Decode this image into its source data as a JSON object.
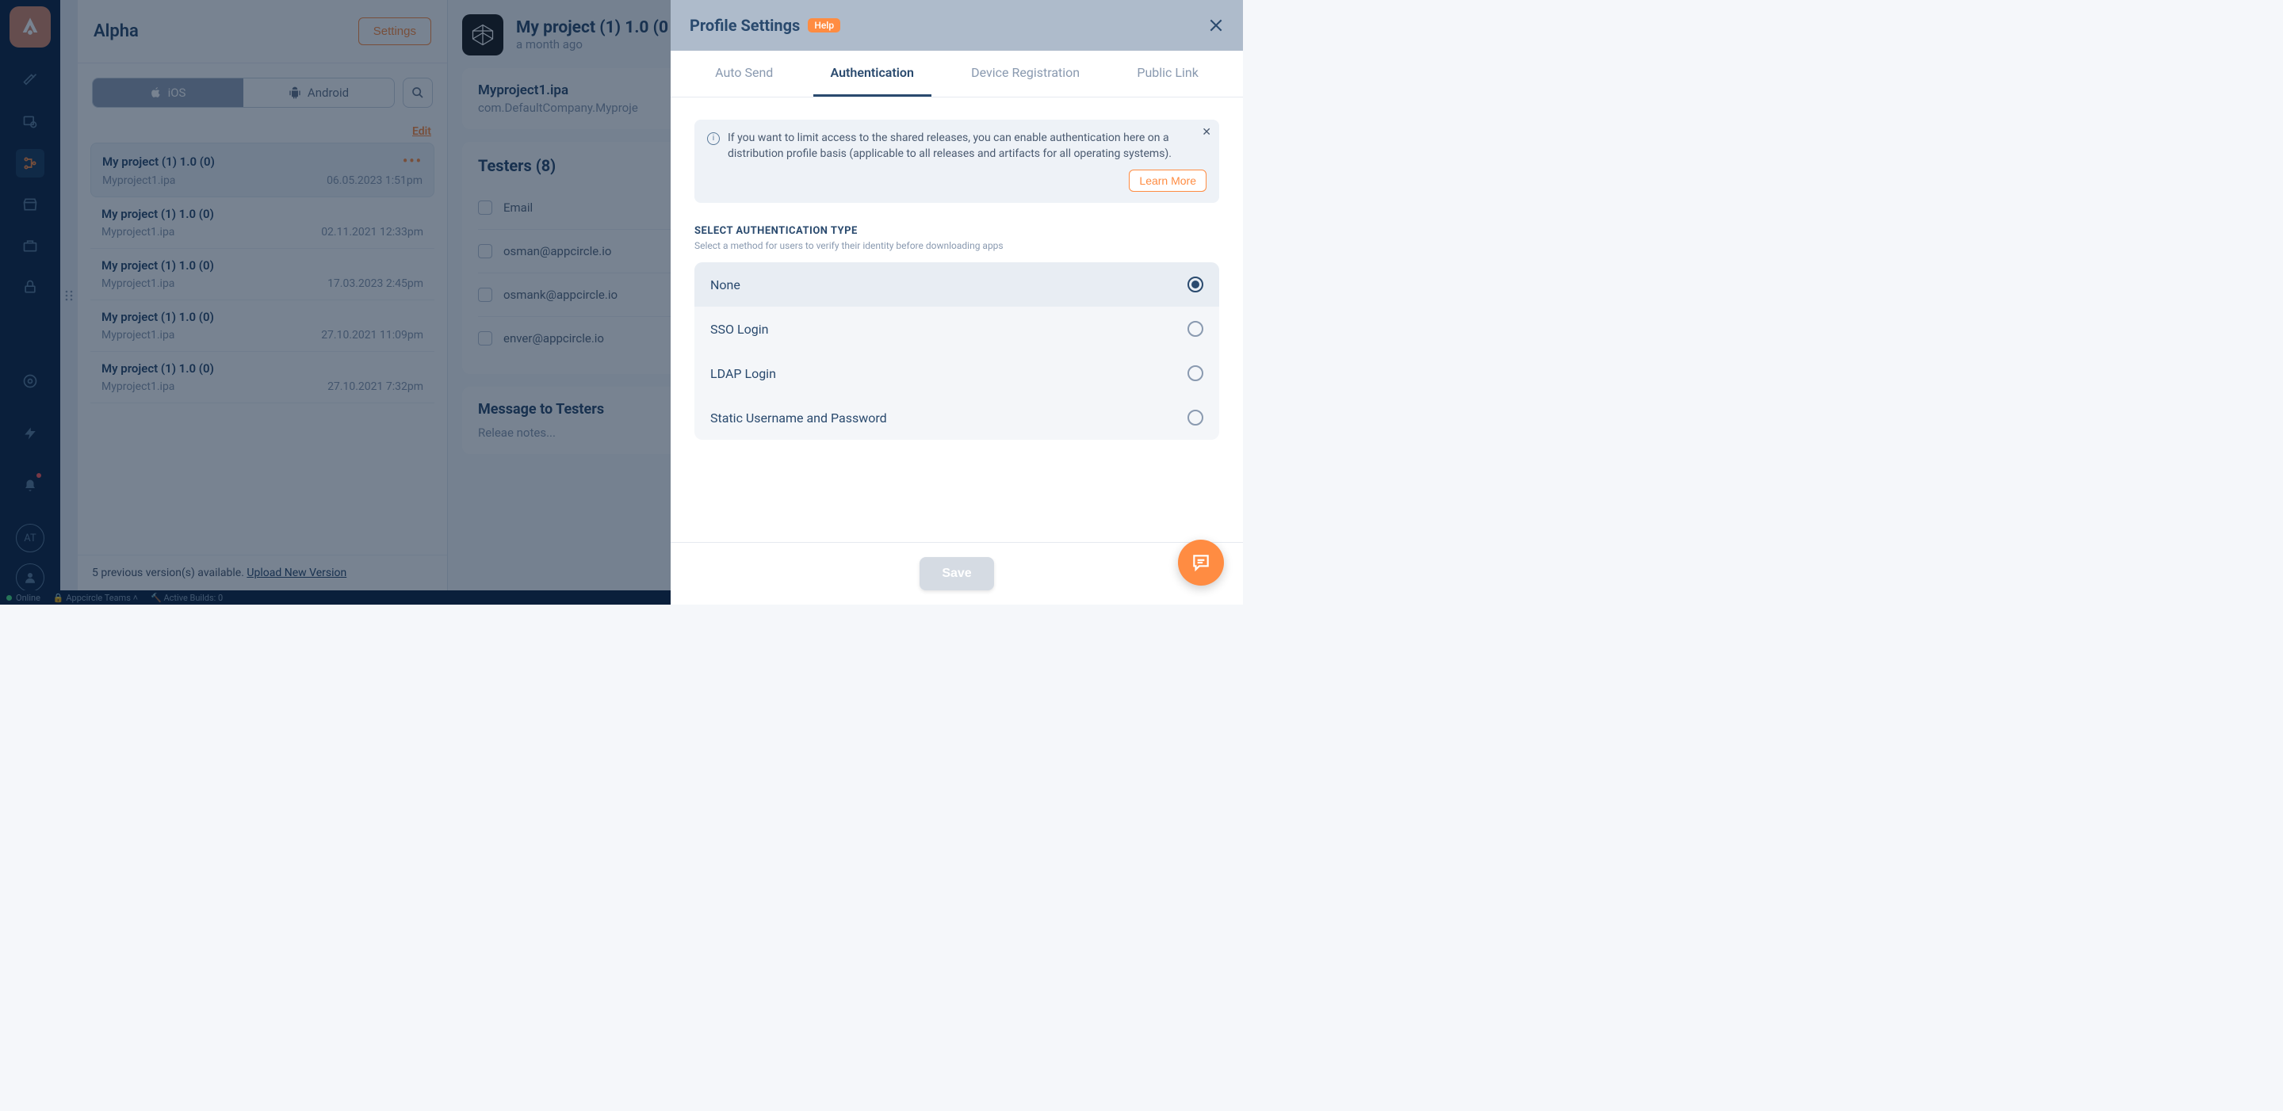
{
  "sidebar": {
    "avatar_initials": "AT"
  },
  "col1": {
    "title": "Alpha",
    "settings_label": "Settings",
    "platform_ios": "iOS",
    "platform_android": "Android",
    "edit_label": "Edit",
    "versions": [
      {
        "title": "My project (1) 1.0 (0)",
        "file": "Myproject1.ipa",
        "date": "06.05.2023 1:51pm",
        "selected": true
      },
      {
        "title": "My project (1) 1.0 (0)",
        "file": "Myproject1.ipa",
        "date": "02.11.2021 12:33pm",
        "selected": false
      },
      {
        "title": "My project (1) 1.0 (0)",
        "file": "Myproject1.ipa",
        "date": "17.03.2023 2:45pm",
        "selected": false
      },
      {
        "title": "My project (1) 1.0 (0)",
        "file": "Myproject1.ipa",
        "date": "27.10.2021 11:09pm",
        "selected": false
      },
      {
        "title": "My project (1) 1.0 (0)",
        "file": "Myproject1.ipa",
        "date": "27.10.2021 7:32pm",
        "selected": false
      }
    ],
    "footer_prefix": "5 previous version(s) available.  ",
    "footer_link": "Upload New Version"
  },
  "col2": {
    "project_title": "My project (1) 1.0 (0",
    "project_time": "a month ago",
    "pkg_name": "Myproject1.ipa",
    "pkg_id": "com.DefaultCompany.Myproje",
    "testers_head": "Testers (8)",
    "tester_header": "Email",
    "testers": [
      "osman@appcircle.io",
      "osmank@appcircle.io",
      "enver@appcircle.io"
    ],
    "msg_head": "Message to Testers",
    "msg_text": "Releae notes..."
  },
  "panel": {
    "title": "Profile Settings",
    "help_label": "Help",
    "tabs": [
      "Auto Send",
      "Authentication",
      "Device Registration",
      "Public Link"
    ],
    "active_tab": 1,
    "info_text": "If you want to limit access to the shared releases, you can enable authentication here on a distribution profile basis (applicable to all releases and artifacts for all operating systems).",
    "learn_more": "Learn More",
    "section_label": "SELECT AUTHENTICATION TYPE",
    "section_sub": "Select a method for users to verify their identity before downloading apps",
    "options": [
      {
        "label": "None",
        "selected": true
      },
      {
        "label": "SSO Login",
        "selected": false
      },
      {
        "label": "LDAP Login",
        "selected": false
      },
      {
        "label": "Static Username and Password",
        "selected": false
      }
    ],
    "save_label": "Save"
  },
  "status": {
    "online": "Online",
    "team": "Appcircle Teams",
    "builds": "Active Builds: 0"
  }
}
